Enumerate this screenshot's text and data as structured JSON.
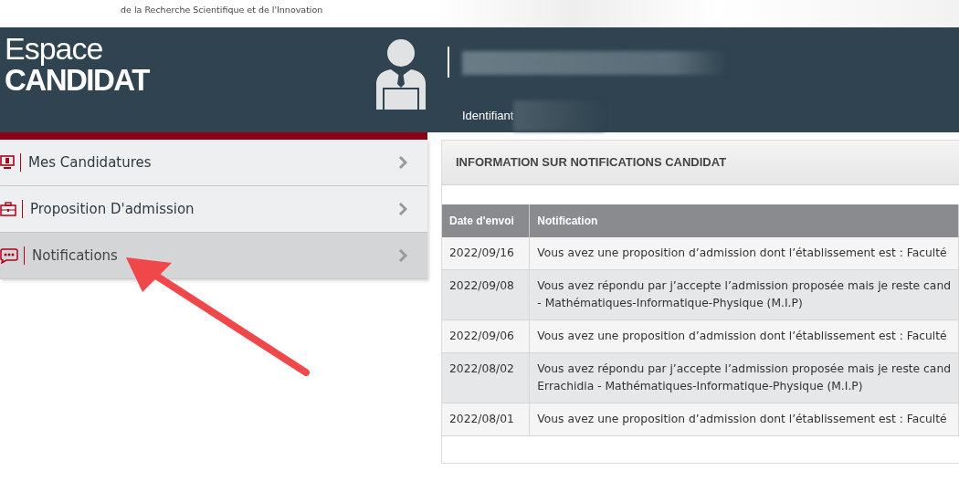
{
  "top_bar": {
    "ministry_line": "de la Recherche Scientifique et de l'Innovation"
  },
  "header": {
    "title_light": "Espace",
    "title_bold": "CANDIDAT",
    "id_label": "Identifiant"
  },
  "sidebar": {
    "items": [
      {
        "label": "Mes Candidatures",
        "selected": false
      },
      {
        "label": "Proposition D'admission",
        "selected": false
      },
      {
        "label": "Notifications",
        "selected": true
      }
    ]
  },
  "panel": {
    "title": "INFORMATION SUR NOTIFICATIONS CANDIDAT",
    "table": {
      "columns": [
        "Date d'envoi",
        "Notification"
      ],
      "rows": [
        {
          "date": "2022/09/16",
          "lines": [
            "Vous avez une proposition d’admission dont l’établissement est : Faculté"
          ]
        },
        {
          "date": "2022/09/08",
          "lines": [
            "Vous avez répondu par j’accepte l’admission proposée mais je reste cand",
            "- Mathématiques-Informatique-Physique (M.I.P)"
          ]
        },
        {
          "date": "2022/09/06",
          "lines": [
            "Vous avez une proposition d’admission dont l’établissement est : Faculté"
          ]
        },
        {
          "date": "2022/08/02",
          "lines": [
            "Vous avez répondu par j’accepte l’admission proposée mais je reste cand",
            "Errachidia - Mathématiques-Informatique-Physique (M.I.P)"
          ]
        },
        {
          "date": "2022/08/01",
          "lines": [
            "Vous avez une proposition d’admission dont l’établissement est : Faculté"
          ]
        }
      ]
    }
  }
}
